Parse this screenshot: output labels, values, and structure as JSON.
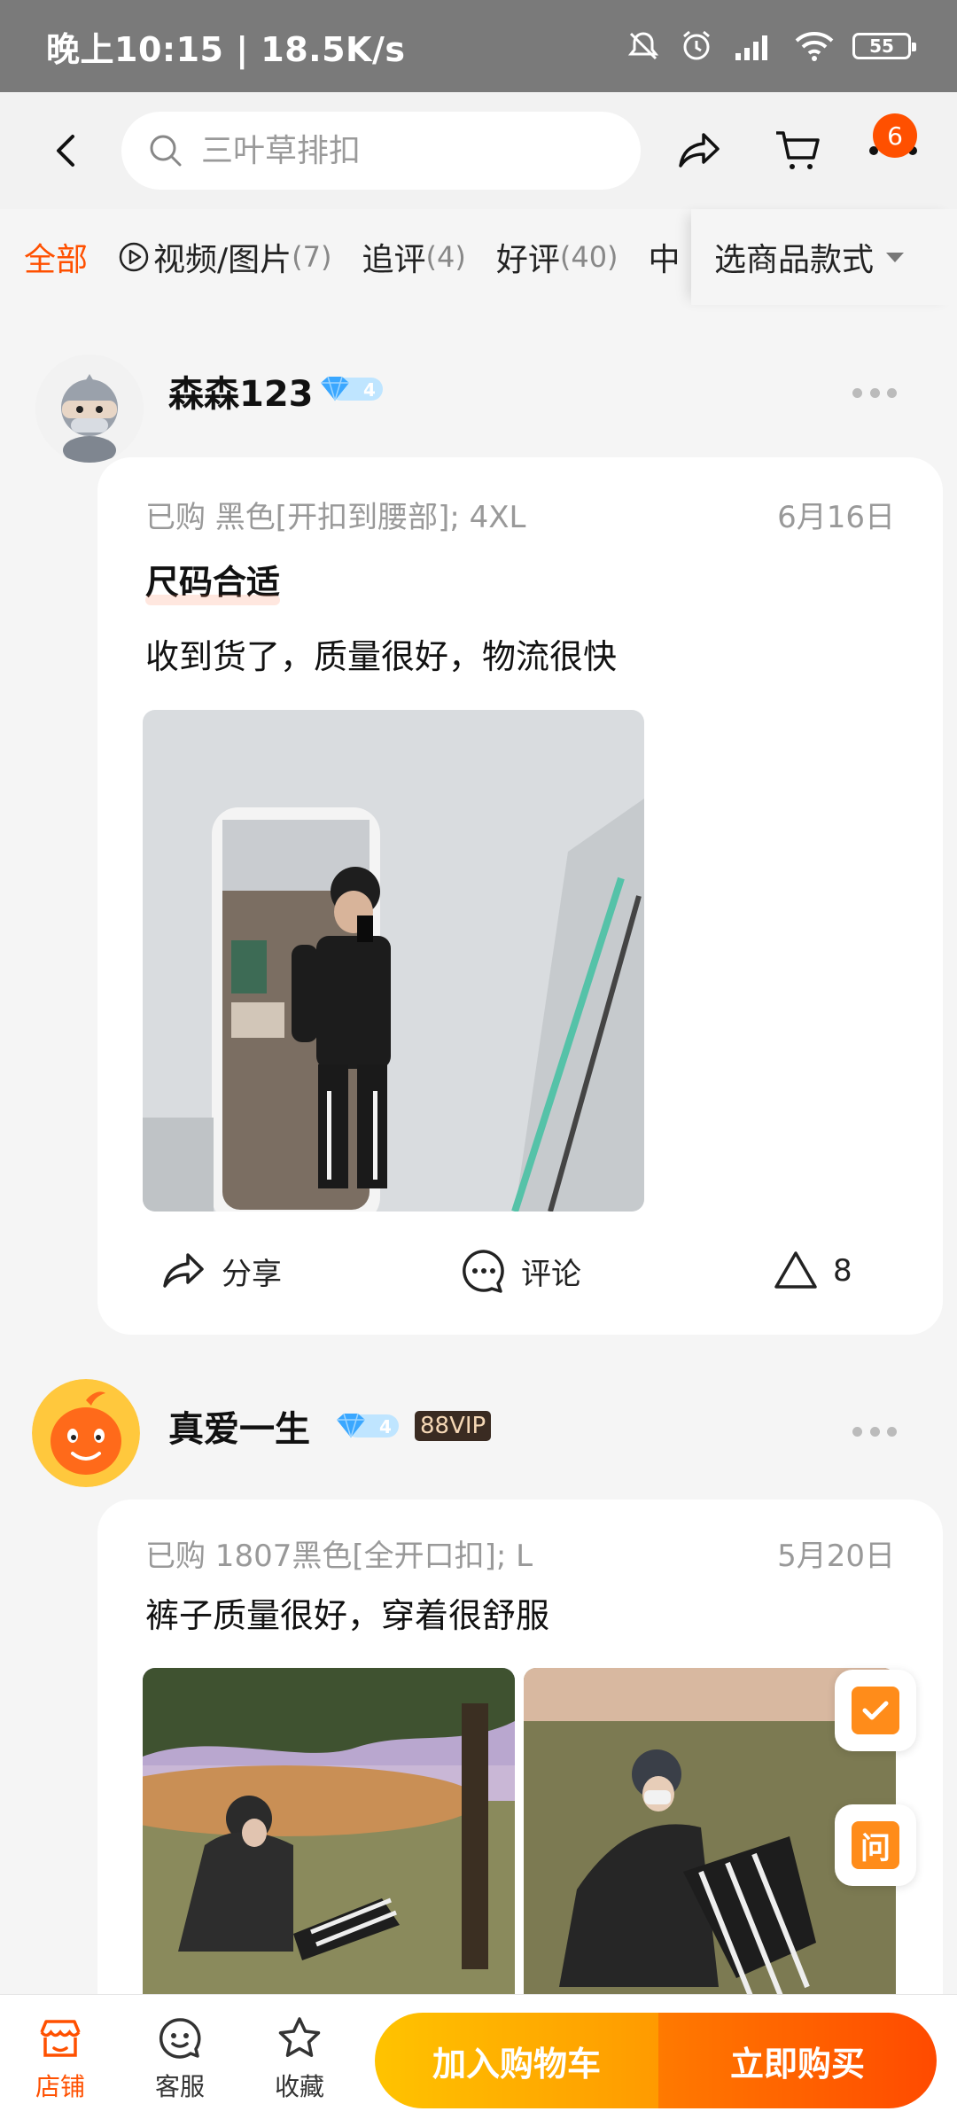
{
  "status_bar": {
    "time": "晚上10:15 | 18.5K/s",
    "battery": "55"
  },
  "nav": {
    "search_placeholder": "三叶草排扣",
    "cart_badge": "6"
  },
  "filters": {
    "all": "全部",
    "video": {
      "label": "视频/图片",
      "count": "(7)"
    },
    "followup": {
      "label": "追评",
      "count": "(4)"
    },
    "good": {
      "label": "好评",
      "count": "(40)"
    },
    "partial": "中",
    "style_select": "选商品款式"
  },
  "reviews": [
    {
      "user": "森森123",
      "level": "4",
      "bought": "已购 黑色[开扣到腰部]; 4XL",
      "date": "6月16日",
      "tag": "尺码合适",
      "text": "收到货了，质量很好，物流很快",
      "actions": {
        "share": "分享",
        "comment": "评论",
        "likes": "8"
      }
    },
    {
      "user": "真爱一生",
      "level": "4",
      "vip": "88VIP",
      "bought": "已购 1807黑色[全开口扣]; L",
      "date": "5月20日",
      "text": "裤子质量很好，穿着很舒服"
    }
  ],
  "floating": {
    "ask": "问"
  },
  "bottom_bar": {
    "store": "店铺",
    "service": "客服",
    "favorite": "收藏",
    "add_to_cart": "加入购物车",
    "buy_now": "立即购买"
  },
  "colors": {
    "accent": "#ff5000",
    "cart_button": "#ffb000",
    "buy_button": "#ff5a00"
  }
}
